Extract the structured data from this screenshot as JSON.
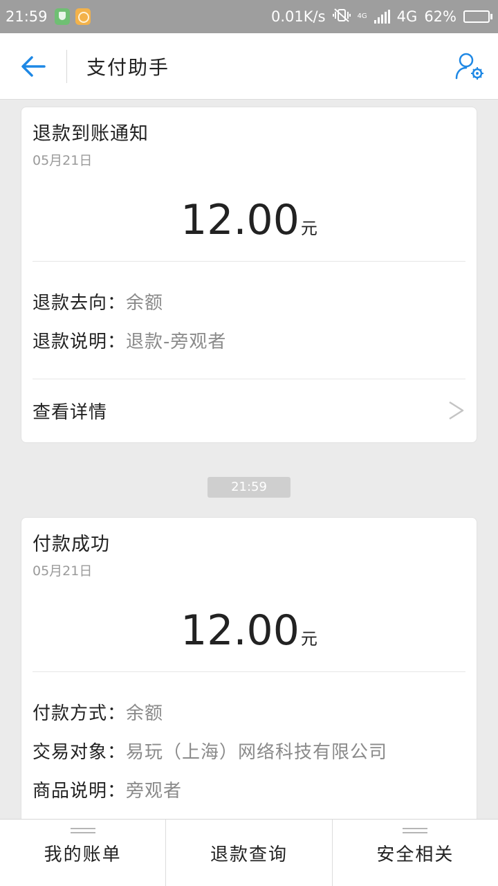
{
  "status": {
    "time": "21:59",
    "speed": "0.01K/s",
    "network": "4G",
    "battery": "62%",
    "battery_level": 0.62,
    "mini_4g": "4G"
  },
  "header": {
    "title": "支付助手",
    "accent": "#1e88e5"
  },
  "cards": [
    {
      "title": "退款到账通知",
      "date": "05月21日",
      "amount": "12.00",
      "unit": "元",
      "rows": [
        {
          "label": "退款去向：",
          "value": "余额"
        },
        {
          "label": "退款说明：",
          "value": "退款-旁观者"
        }
      ],
      "detail": "查看详情"
    },
    {
      "title": "付款成功",
      "date": "05月21日",
      "amount": "12.00",
      "unit": "元",
      "rows": [
        {
          "label": "付款方式：",
          "value": "余额"
        },
        {
          "label": "交易对象：",
          "value": "易玩（上海）网络科技有限公司"
        },
        {
          "label": "商品说明：",
          "value": "旁观者"
        }
      ]
    }
  ],
  "separator_time": "21:59",
  "bottom_nav": [
    {
      "label": "我的账单"
    },
    {
      "label": "退款查询"
    },
    {
      "label": "安全相关"
    }
  ]
}
